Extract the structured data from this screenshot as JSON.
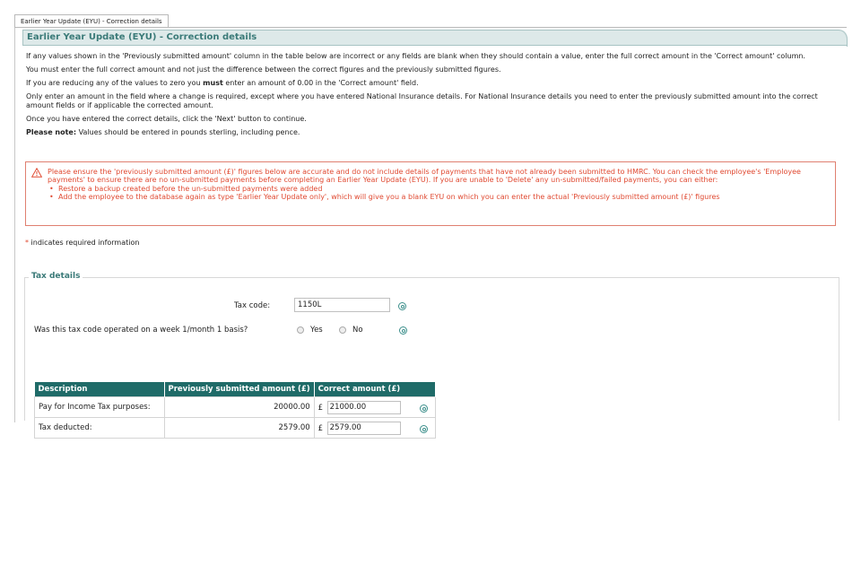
{
  "tab": {
    "label": "Earlier Year Update (EYU) - Correction details"
  },
  "panel": {
    "title": "Earlier Year Update (EYU) - Correction details"
  },
  "instructions": {
    "p1": "If any values shown in the 'Previously submitted amount' column in the table below are incorrect or any fields are blank when they should contain a value, enter the full correct amount in the 'Correct amount' column.",
    "p2": "You must enter the full correct amount and not just the difference between the correct figures and the previously submitted figures.",
    "p3_pre": "If you are reducing any of the values to zero you ",
    "p3_bold": "must",
    "p3_post": " enter an amount of 0.00 in the 'Correct amount' field.",
    "p4": "Only enter an amount in the field where a change is required, except where you have entered National Insurance details. For National Insurance details you need to enter the previously submitted amount into the correct amount fields or if applicable the corrected amount.",
    "p5": "Once you have entered the correct details, click the 'Next' button to continue.",
    "p6_bold": "Please note:",
    "p6_post": " Values should be entered in pounds sterling, including pence."
  },
  "warning": {
    "text": "Please ensure the 'previously submitted amount (£)' figures below are accurate and do not include details of payments that have not already been submitted to HMRC. You can check the employee's 'Employee payments' to ensure there are no un-submitted payments before completing an Earlier Year Update (EYU). If you are unable to 'Delete' any un-submitted/failed payments, you can either:",
    "items": [
      "Restore a backup created before the un-submitted payments were added",
      "Add the employee to the database again as type 'Earlier Year Update only', which will give you a blank EYU on which you can enter the actual 'Previously submitted amount (£)' figures"
    ],
    "color": "#e04a32"
  },
  "required_note": {
    "star": "*",
    "text": " indicates required information"
  },
  "tax_details": {
    "legend": "Tax details",
    "tax_code_label": "Tax code:",
    "tax_code_value": "1150L",
    "week1_label": "Was this tax code operated on a week 1/month 1 basis?",
    "yes_label": "Yes",
    "no_label": "No",
    "table": {
      "headers": [
        "Description",
        "Previously submitted amount (£)",
        "Correct amount (£)"
      ],
      "rows": [
        {
          "description": "Pay for Income Tax purposes:",
          "previous": "20000.00",
          "currency": "£",
          "correct": "21000.00"
        },
        {
          "description": "Tax deducted:",
          "previous": "2579.00",
          "currency": "£",
          "correct": "2579.00"
        }
      ]
    }
  },
  "colors": {
    "accent": "#3a7a78",
    "header_bg": "#1f6b68",
    "panel_header_bg": "#dde9e9"
  }
}
